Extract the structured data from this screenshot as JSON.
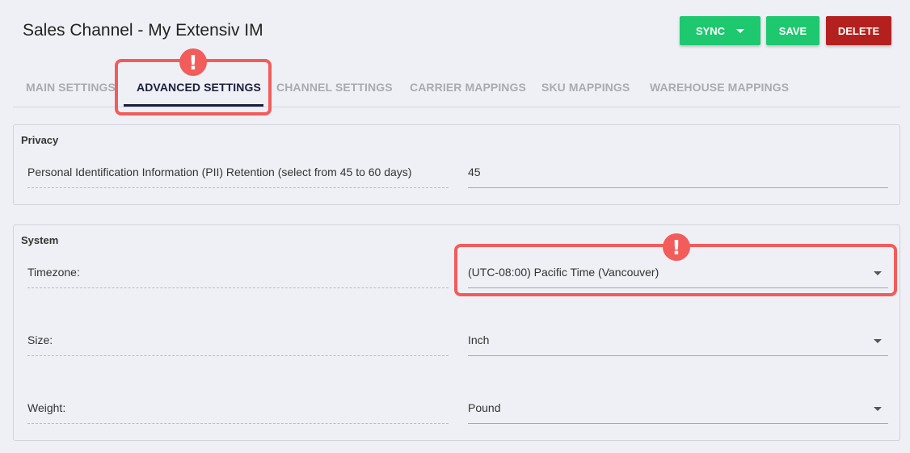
{
  "header": {
    "title": "Sales Channel - My Extensiv IM",
    "sync_label": "SYNC",
    "save_label": "SAVE",
    "delete_label": "DELETE"
  },
  "tabs": [
    {
      "label": "MAIN SETTINGS",
      "active": false
    },
    {
      "label": "ADVANCED SETTINGS",
      "active": true
    },
    {
      "label": "CHANNEL SETTINGS",
      "active": false
    },
    {
      "label": "CARRIER MAPPINGS",
      "active": false
    },
    {
      "label": "SKU MAPPINGS",
      "active": false
    },
    {
      "label": "WAREHOUSE MAPPINGS",
      "active": false
    }
  ],
  "privacy": {
    "title": "Privacy",
    "pii_label": "Personal Identification Information (PII) Retention (select from 45 to 60 days)",
    "pii_value": "45"
  },
  "system": {
    "title": "System",
    "timezone_label": "Timezone:",
    "timezone_value": "(UTC-08:00) Pacific Time (Vancouver)",
    "size_label": "Size:",
    "size_value": "Inch",
    "weight_label": "Weight:",
    "weight_value": "Pound"
  },
  "annotations": {
    "badge_symbol": "!"
  },
  "colors": {
    "primary_button": "#1ec86f",
    "danger_button": "#b3201e",
    "highlight": "#f25c5a",
    "active_tab": "#1a1f3d"
  }
}
